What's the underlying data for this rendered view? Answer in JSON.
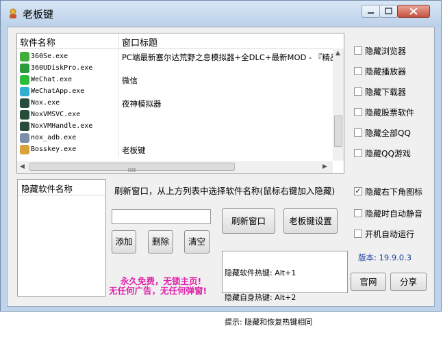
{
  "window": {
    "title": "老板键"
  },
  "icons": {
    "app": "bosskey-app-icon"
  },
  "colors": {
    "promo": "#e020a8",
    "version": "#1a3f9c"
  },
  "process_list": {
    "headers": [
      "软件名称",
      "窗口标题"
    ],
    "rows": [
      {
        "icon": "360se-icon",
        "color": "#3fae3a",
        "name": "360Se.exe",
        "title": "PC端最新塞尔达荒野之息模拟器+全DLC+最新MOD - 『精品"
      },
      {
        "icon": "360udisk-icon",
        "color": "#2a9a3a",
        "name": "360UDiskPro.exe",
        "title": ""
      },
      {
        "icon": "wechat-icon",
        "color": "#2dbb3a",
        "name": "WeChat.exe",
        "title": "微信"
      },
      {
        "icon": "wechatapp-icon",
        "color": "#30b0d0",
        "name": "WeChatApp.exe",
        "title": ""
      },
      {
        "icon": "nox-icon",
        "color": "#274d3a",
        "name": "Nox.exe",
        "title": "夜神模拟器"
      },
      {
        "icon": "noxvmsvc-icon",
        "color": "#274d3a",
        "name": "NoxVMSVC.exe",
        "title": ""
      },
      {
        "icon": "noxvmhandle-icon",
        "color": "#274d3a",
        "name": "NoxVMHandle.exe",
        "title": ""
      },
      {
        "icon": "nox-adb-icon",
        "color": "#7c8ea8",
        "name": "nox_adb.exe",
        "title": ""
      },
      {
        "icon": "bosskey-icon",
        "color": "#d9a23a",
        "name": "Bosskey.exe",
        "title": "老板键"
      }
    ]
  },
  "options": [
    {
      "label": "隐藏浏览器",
      "checked": false
    },
    {
      "label": "隐藏播放器",
      "checked": false
    },
    {
      "label": "隐藏下载器",
      "checked": false
    },
    {
      "label": "隐藏股票软件",
      "checked": false
    },
    {
      "label": "隐藏全部QQ",
      "checked": false
    },
    {
      "label": "隐藏QQ游戏",
      "checked": false
    },
    {
      "label": "隐藏右下角图标",
      "checked": true
    },
    {
      "label": "隐藏时自动静音",
      "checked": false
    },
    {
      "label": "开机自动运行",
      "checked": false
    }
  ],
  "hidden_list": {
    "header": "隐藏软件名称"
  },
  "hint": "刷新窗口，从上方列表中选择软件名称(鼠标右键加入隐藏)",
  "input": {
    "value": ""
  },
  "buttons": {
    "add": "添加",
    "delete": "删除",
    "clear": "清空",
    "refresh": "刷新窗口",
    "settings": "老板键设置",
    "website": "官网",
    "share": "分享"
  },
  "hotkey_info": {
    "line1": "隐藏软件热键: Alt+1",
    "line2": "隐藏自身热键: Alt+2",
    "line3": "提示: 隐藏和恢复热键相同"
  },
  "version": "版本: 19.9.0.3",
  "promo": {
    "line1": "永久免费，无锁主页!",
    "line2": "无任何广告，无任何弹窗!"
  }
}
